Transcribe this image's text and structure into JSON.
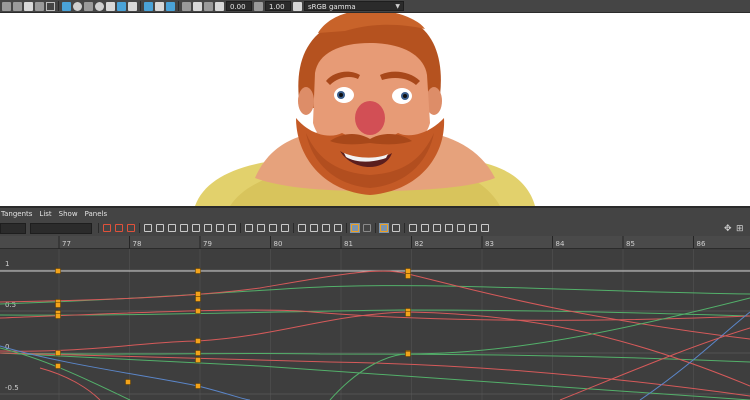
{
  "viewport_toolbar": {
    "field_a": "0.00",
    "field_b": "1.00",
    "color_space": "sRGB gamma"
  },
  "menu": {
    "items": [
      "Tangents",
      "List",
      "Show",
      "Panels"
    ]
  },
  "graph": {
    "frame_labels": [
      "77",
      "78",
      "79",
      "80",
      "81",
      "82",
      "83",
      "84",
      "85",
      "86"
    ],
    "value_labels": [
      "1",
      "0.5",
      "0",
      "-0.5"
    ],
    "colors": {
      "red": "#d65a5a",
      "green": "#53b06a",
      "blue": "#5b86c9",
      "key": "#f3a31a",
      "grid": "#5a5a5a"
    }
  },
  "toolbar_icons": [
    "key-icon",
    "break-icon",
    "frame-all-icon",
    "tangent-spline-icon",
    "tangent-linear-icon",
    "tangent-flat-icon",
    "tangent-step-icon",
    "tangent-plateau-icon",
    "buffer-curve-icon",
    "infinity-icon",
    "pre-infinity-icon",
    "post-infinity-icon",
    "curve-select-icon",
    "lock-icon",
    "stack-icon",
    "normalize-icon",
    "denormalize-icon",
    "snapshot-icon",
    "retime-icon",
    "curve-filter-icon"
  ]
}
